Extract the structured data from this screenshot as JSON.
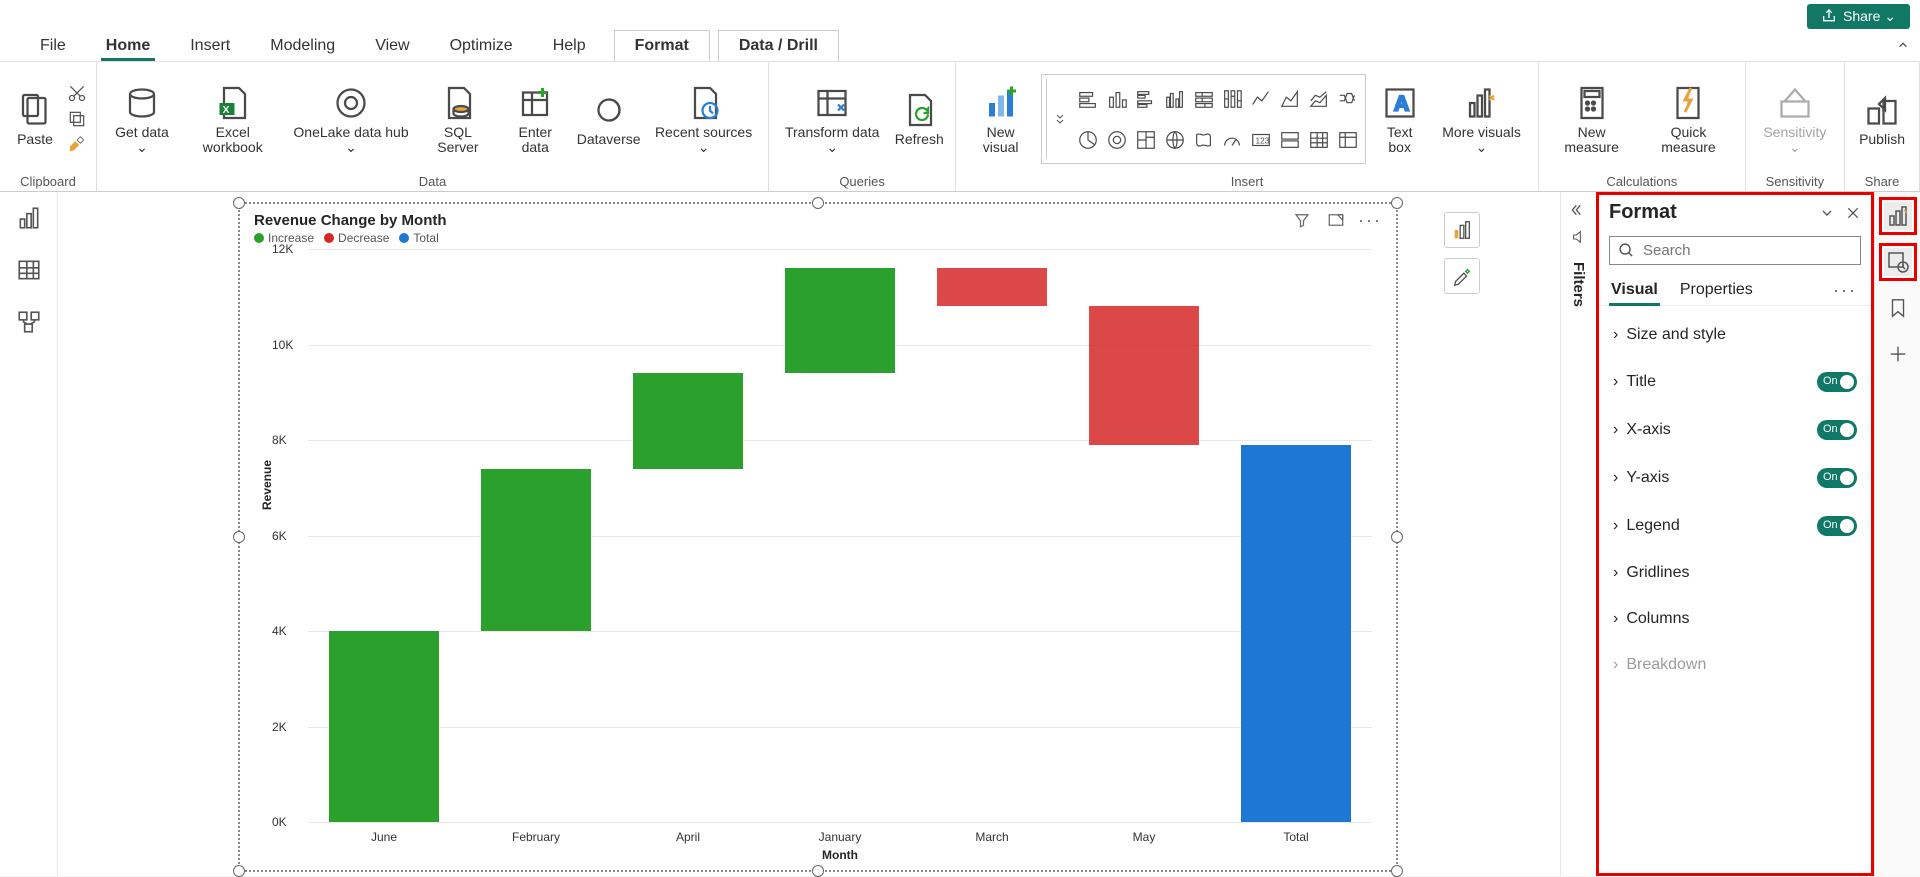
{
  "titlebar": {
    "share": "Share ⌄"
  },
  "menu": {
    "tabs": [
      "File",
      "Home",
      "Insert",
      "Modeling",
      "View",
      "Optimize",
      "Help"
    ],
    "active": "Home",
    "context": [
      "Format",
      "Data / Drill"
    ]
  },
  "ribbon": {
    "groups": {
      "clipboard": {
        "label": "Clipboard",
        "paste": "Paste"
      },
      "data": {
        "label": "Data",
        "get_data": "Get data ⌄",
        "excel": "Excel workbook",
        "onelake": "OneLake data hub ⌄",
        "sql": "SQL Server",
        "enter": "Enter data",
        "dataverse": "Dataverse",
        "recent": "Recent sources ⌄"
      },
      "queries": {
        "label": "Queries",
        "transform": "Transform data ⌄",
        "refresh": "Refresh"
      },
      "insert": {
        "label": "Insert",
        "new_visual": "New visual",
        "text_box": "Text box",
        "more_visuals": "More visuals ⌄"
      },
      "calculations": {
        "label": "Calculations",
        "new_measure": "New measure",
        "quick_measure": "Quick measure"
      },
      "sensitivity": {
        "label": "Sensitivity",
        "btn": "Sensitivity ⌄"
      },
      "share": {
        "label": "Share",
        "publish": "Publish"
      }
    }
  },
  "filters": {
    "label": "Filters"
  },
  "format_pane": {
    "title": "Format",
    "search_placeholder": "Search",
    "tabs": {
      "visual": "Visual",
      "properties": "Properties"
    },
    "sections": {
      "size_style": "Size and style",
      "title": "Title",
      "xaxis": "X-axis",
      "yaxis": "Y-axis",
      "legend": "Legend",
      "gridlines": "Gridlines",
      "columns": "Columns",
      "breakdown": "Breakdown"
    },
    "toggle_on": "On"
  },
  "chart_data": {
    "type": "waterfall",
    "title": "Revenue Change by Month",
    "xlabel": "Month",
    "ylabel": "Revenue",
    "ylim": [
      0,
      12000
    ],
    "y_ticks": [
      "0K",
      "2K",
      "4K",
      "6K",
      "8K",
      "10K",
      "12K"
    ],
    "legend": [
      {
        "name": "Increase",
        "color": "#2CA02C"
      },
      {
        "name": "Decrease",
        "color": "#D62728"
      },
      {
        "name": "Total",
        "color": "#1F77D4"
      }
    ],
    "categories": [
      "June",
      "February",
      "April",
      "January",
      "March",
      "May",
      "Total"
    ],
    "series": [
      {
        "category": "June",
        "kind": "increase",
        "start": 0,
        "end": 4000
      },
      {
        "category": "February",
        "kind": "increase",
        "start": 4000,
        "end": 7400
      },
      {
        "category": "April",
        "kind": "increase",
        "start": 7400,
        "end": 9400
      },
      {
        "category": "January",
        "kind": "increase",
        "start": 9400,
        "end": 11600
      },
      {
        "category": "March",
        "kind": "decrease",
        "start": 11600,
        "end": 10800
      },
      {
        "category": "May",
        "kind": "decrease",
        "start": 10800,
        "end": 7900
      },
      {
        "category": "Total",
        "kind": "total",
        "start": 0,
        "end": 7900
      }
    ]
  }
}
